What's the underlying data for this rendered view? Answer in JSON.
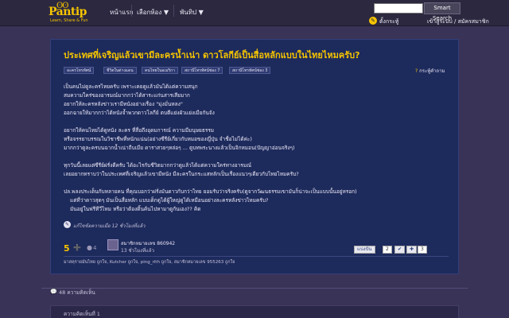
{
  "header": {
    "logo_mark": "ʘʘ",
    "logo_name": "Pantip",
    "logo_tagline": "Learn, Share & Fun",
    "nav": [
      "หน้าแรก",
      "เลือกห้อง ▼",
      "พันทิป ▼"
    ],
    "search_button": "Smart Search",
    "search_value": "",
    "shop_label": "ตั้งกระทู้",
    "login_label": "เข้าสู่ระบบ / สมัครสมาชิก"
  },
  "post": {
    "title": "ประเทศที่เจริญแล้วเขามีละครน้ำเน่า ดาวโลกีย์เป็นสื่อหลักแบบในไทยไหมครับ?",
    "tags": [
      "ละครโทรทัศน์",
      "ชีวิตในต่างแดน",
      "คนไทยในอเมริกา",
      "สถานีโทรทัศน์ช่อง 7",
      "สถานีโทรทัศน์ช่อง 3"
    ],
    "bookmark": "กระทู้คำถาม",
    "lines": [
      "เป็นคนไม่ดูละครไทยครับ เพราะเคยดูแล้วมันได้แต่ความสนุก",
      "สมความใคร่ของอารมณ์มากกว่าได้สาระแก่นสารเสียมาก",
      "อยากให้ละครหลังข่าวเรามีหนังอย่างเรื่อง \"มุ่งมั่นหลง\"",
      "ออกฉายให้มากกว่าได้หนังจ้ำพวกดาวโลกีย์ ตบตีแย่งผัวแย่งเมียกันจัง",
      "",
      "อยากให้คนไทยได้ดูหนัง ละคร ที่สื่อถึงอุดมการณ์ ความมีมนุษยธรรม",
      "หรือจรรยาบรรณในวิชาชีพที่หนักแน่น(อย่างซีรีย์เกี่ยวกับหมอของญี่ปุ่น จำชื่อไม่ได้ค่ะ)",
      "มากกว่าดูละครบนฉากน้ำเน่าถีบเมีย ดาราสวยๆหล่อๆ ... ดูบทพระนางแล้วเป็นจิกหมอน(ปัญญาอ่อนจริงๆ)",
      "",
      "ทุกวันนี้เลยแต่ซีรีย์ฝรั่งดีครับ ได้อะไรกับชีวิตมากกว่าดูแล้วได้แต่ความใคร่ทางอารมณ์",
      "เลยอยากทราบว่าในประเทศที่เจริญแล้วเขามีหนัง มีละครในกระแสหลักเป็นเรื่องแนวๆเดียวกับไทยไหมครับ?",
      "",
      "ปล.พลงประเด็นกับหลายคน ที่คุณบอกว่าฝรั่งมันดาวกับกว่าไทย ยอมรับว่าจริงครับ(ดูจากวัฒนธรรมเขามันก็น่าจะเป็นแบบนั้นอยู่หรอก)",
      "แต่ที่ว่าดาวสุดๆ มันเป็นสื่อหลัก แบบเด็กดูได้ผู้ใหญ่ดูได้เหมือนอย่างละครหลังข่าวไหมครับ?",
      "มันอยู่ในฟรีทีวีไหม หรือว่าต้องดิ้นค้นไปหามาดูกันเอง?? คิด"
    ],
    "edit_note": "แก้ไขข้อความเมื่อ 12 ชั่วโมงที่แล้ว",
    "score": "5",
    "minus_score": "4",
    "author": "สมาชิกหมายเลข 860942",
    "author_time": "13 ชั่วโมงที่แล้ว",
    "share_label": "แบ่งปัน",
    "share_count": "2",
    "tweet_count": "3",
    "liked_by": "มาสคุรายมันไทย ถูกใจ, Kutcher ถูกใจ, ping_rith ถูกใจ, สมาชิกหมายเลข 955263 ถูกใจ"
  },
  "comments": {
    "count_label": "48 ความคิดเห็น",
    "first_label": "ความคิดเห็นที่ 1"
  }
}
